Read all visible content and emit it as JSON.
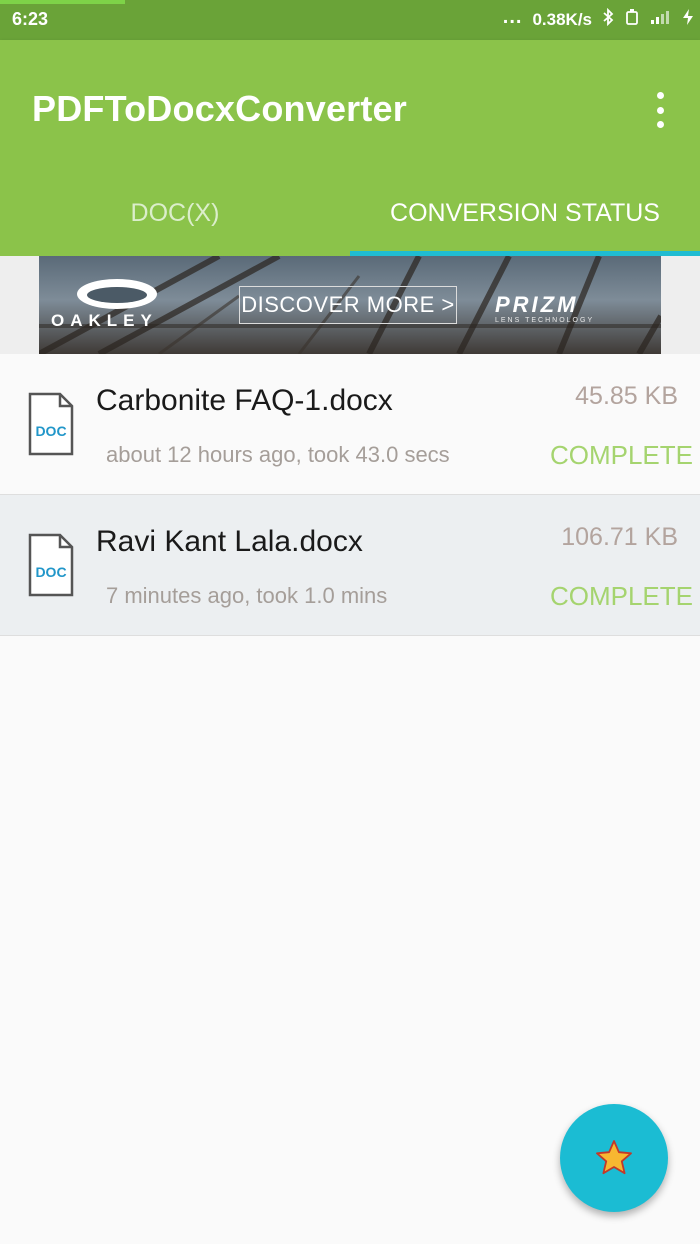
{
  "status_bar": {
    "time": "6:23",
    "dots": "...",
    "network_speed": "0.38K/s"
  },
  "app_bar": {
    "title": "PDFToDocxConverter",
    "tabs": [
      {
        "label": "DOC(X)",
        "active": false
      },
      {
        "label": "CONVERSION STATUS",
        "active": true
      }
    ]
  },
  "ad": {
    "brand": "OAKLEY",
    "cta": "DISCOVER MORE >",
    "product": "PRIZM",
    "product_sub": "LENS TECHNOLOGY"
  },
  "conversions": [
    {
      "icon_label": "DOC",
      "file_name": "Carbonite FAQ-1.docx",
      "meta": "about 12 hours ago, took 43.0 secs",
      "size": "45.85 KB",
      "status": "COMPLETE"
    },
    {
      "icon_label": "DOC",
      "file_name": "Ravi Kant Lala.docx",
      "meta": "7 minutes ago, took 1.0 mins",
      "size": "106.71 KB",
      "status": "COMPLETE"
    }
  ],
  "colors": {
    "status_bar": "#6aa338",
    "app_bar": "#8bc34a",
    "tab_indicator": "#1fbcd2",
    "complete_status": "#a5d46f",
    "fab": "#1bbcd3",
    "doc_icon_text": "#2196c9"
  },
  "fab": {
    "icon": "star-icon"
  }
}
